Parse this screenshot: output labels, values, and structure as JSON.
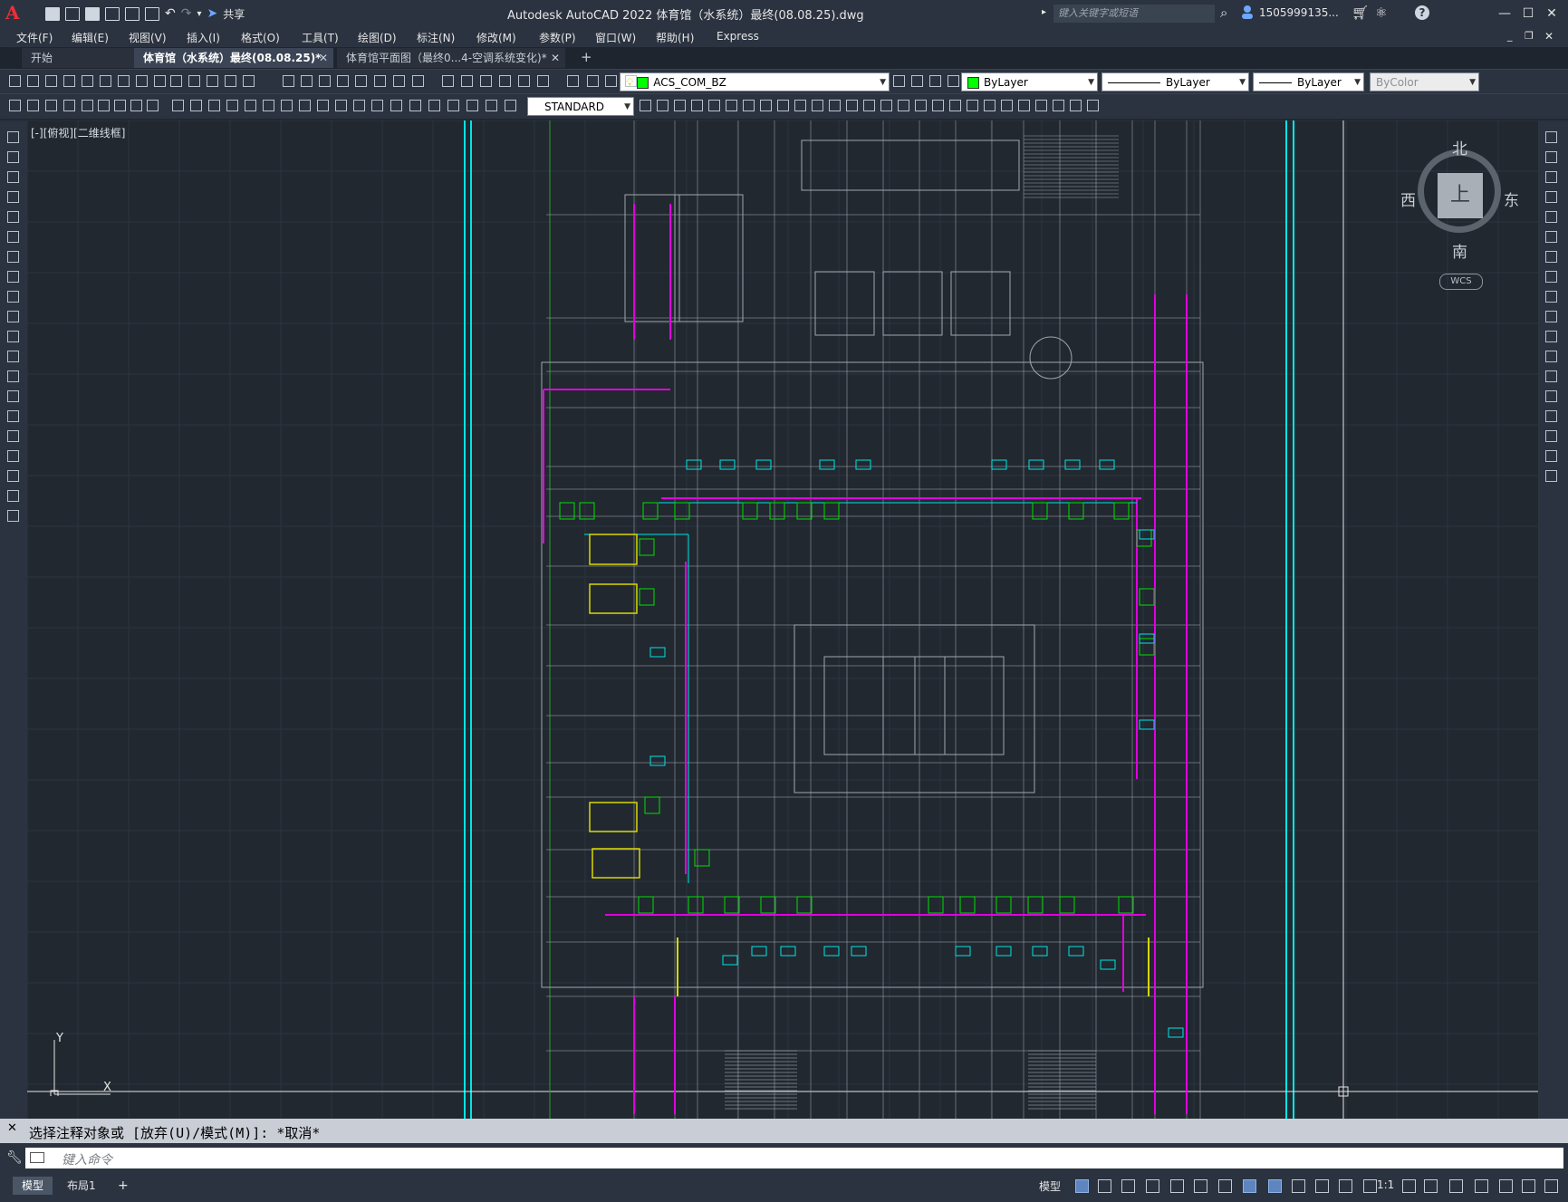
{
  "app": {
    "logo": "A",
    "title": "Autodesk AutoCAD 2022    体育馆（水系统）最终(08.08.25).dwg",
    "share_label": "共享",
    "search_placeholder": "键入关键字或短语",
    "user": "1505999135...",
    "icons": [
      "new-icon",
      "open-icon",
      "save-icon",
      "saveas-icon",
      "web-icon",
      "plot-icon",
      "undo-icon",
      "redo-icon",
      "share-icon",
      "search-icon",
      "user-icon",
      "cart-icon",
      "a360-icon",
      "help-icon"
    ]
  },
  "menu": [
    "文件(F)",
    "编辑(E)",
    "视图(V)",
    "插入(I)",
    "格式(O)",
    "工具(T)",
    "绘图(D)",
    "标注(N)",
    "修改(M)",
    "参数(P)",
    "窗口(W)",
    "帮助(H)",
    "Express"
  ],
  "tabs": [
    {
      "label": "开始",
      "state": "inactive"
    },
    {
      "label": "体育馆（水系统）最终(08.08.25)*",
      "state": "active"
    },
    {
      "label": "体育馆平面图（最终0...4-空调系统变化)*",
      "state": "inactive"
    }
  ],
  "toolbar": {
    "layer": "ACS_COM_BZ",
    "layer_color": "#00ff00",
    "color": "ByLayer",
    "color_swatch": "#00ff00",
    "linetype": "ByLayer",
    "lineweight": "ByLayer",
    "plotstyle": "ByColor",
    "textstyle": "STANDARD"
  },
  "viewport": {
    "label": "[-][俯视][二维线框]",
    "compass": {
      "north": "北",
      "south": "南",
      "east": "东",
      "west": "西",
      "top": "上"
    },
    "wcs": "WCS",
    "ucs_x": "X",
    "ucs_y": "Y"
  },
  "command": {
    "history": "选择注释对象或 [放弃(U)/模式(M)]: *取消*",
    "placeholder": "键入命令"
  },
  "status": {
    "layouts": [
      "模型",
      "布局1"
    ],
    "add_layout": "+",
    "model_label": "模型",
    "scale": "1:1"
  },
  "colors": {
    "cyan": "#00e5e5",
    "magenta": "#e000e0",
    "green": "#00e000",
    "yellow": "#d8d800",
    "background": "#212830",
    "grey_line": "#a0a6ad"
  }
}
